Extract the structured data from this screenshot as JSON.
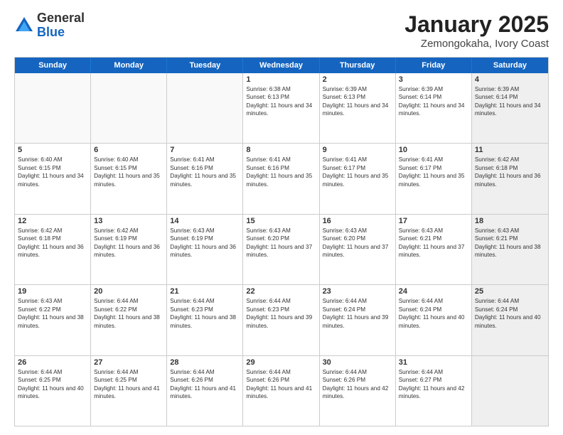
{
  "logo": {
    "general": "General",
    "blue": "Blue"
  },
  "title": "January 2025",
  "subtitle": "Zemongokaha, Ivory Coast",
  "days": [
    "Sunday",
    "Monday",
    "Tuesday",
    "Wednesday",
    "Thursday",
    "Friday",
    "Saturday"
  ],
  "weeks": [
    [
      {
        "day": "",
        "empty": true
      },
      {
        "day": "",
        "empty": true
      },
      {
        "day": "",
        "empty": true
      },
      {
        "day": "1",
        "sunrise": "6:38 AM",
        "sunset": "6:13 PM",
        "daylight": "11 hours and 34 minutes."
      },
      {
        "day": "2",
        "sunrise": "6:39 AM",
        "sunset": "6:13 PM",
        "daylight": "11 hours and 34 minutes."
      },
      {
        "day": "3",
        "sunrise": "6:39 AM",
        "sunset": "6:14 PM",
        "daylight": "11 hours and 34 minutes."
      },
      {
        "day": "4",
        "sunrise": "6:39 AM",
        "sunset": "6:14 PM",
        "daylight": "11 hours and 34 minutes.",
        "shaded": true
      }
    ],
    [
      {
        "day": "5",
        "sunrise": "6:40 AM",
        "sunset": "6:15 PM",
        "daylight": "11 hours and 34 minutes."
      },
      {
        "day": "6",
        "sunrise": "6:40 AM",
        "sunset": "6:15 PM",
        "daylight": "11 hours and 35 minutes."
      },
      {
        "day": "7",
        "sunrise": "6:41 AM",
        "sunset": "6:16 PM",
        "daylight": "11 hours and 35 minutes."
      },
      {
        "day": "8",
        "sunrise": "6:41 AM",
        "sunset": "6:16 PM",
        "daylight": "11 hours and 35 minutes."
      },
      {
        "day": "9",
        "sunrise": "6:41 AM",
        "sunset": "6:17 PM",
        "daylight": "11 hours and 35 minutes."
      },
      {
        "day": "10",
        "sunrise": "6:41 AM",
        "sunset": "6:17 PM",
        "daylight": "11 hours and 35 minutes."
      },
      {
        "day": "11",
        "sunrise": "6:42 AM",
        "sunset": "6:18 PM",
        "daylight": "11 hours and 36 minutes.",
        "shaded": true
      }
    ],
    [
      {
        "day": "12",
        "sunrise": "6:42 AM",
        "sunset": "6:18 PM",
        "daylight": "11 hours and 36 minutes."
      },
      {
        "day": "13",
        "sunrise": "6:42 AM",
        "sunset": "6:19 PM",
        "daylight": "11 hours and 36 minutes."
      },
      {
        "day": "14",
        "sunrise": "6:43 AM",
        "sunset": "6:19 PM",
        "daylight": "11 hours and 36 minutes."
      },
      {
        "day": "15",
        "sunrise": "6:43 AM",
        "sunset": "6:20 PM",
        "daylight": "11 hours and 37 minutes."
      },
      {
        "day": "16",
        "sunrise": "6:43 AM",
        "sunset": "6:20 PM",
        "daylight": "11 hours and 37 minutes."
      },
      {
        "day": "17",
        "sunrise": "6:43 AM",
        "sunset": "6:21 PM",
        "daylight": "11 hours and 37 minutes."
      },
      {
        "day": "18",
        "sunrise": "6:43 AM",
        "sunset": "6:21 PM",
        "daylight": "11 hours and 38 minutes.",
        "shaded": true
      }
    ],
    [
      {
        "day": "19",
        "sunrise": "6:43 AM",
        "sunset": "6:22 PM",
        "daylight": "11 hours and 38 minutes."
      },
      {
        "day": "20",
        "sunrise": "6:44 AM",
        "sunset": "6:22 PM",
        "daylight": "11 hours and 38 minutes."
      },
      {
        "day": "21",
        "sunrise": "6:44 AM",
        "sunset": "6:23 PM",
        "daylight": "11 hours and 38 minutes."
      },
      {
        "day": "22",
        "sunrise": "6:44 AM",
        "sunset": "6:23 PM",
        "daylight": "11 hours and 39 minutes."
      },
      {
        "day": "23",
        "sunrise": "6:44 AM",
        "sunset": "6:24 PM",
        "daylight": "11 hours and 39 minutes."
      },
      {
        "day": "24",
        "sunrise": "6:44 AM",
        "sunset": "6:24 PM",
        "daylight": "11 hours and 40 minutes."
      },
      {
        "day": "25",
        "sunrise": "6:44 AM",
        "sunset": "6:24 PM",
        "daylight": "11 hours and 40 minutes.",
        "shaded": true
      }
    ],
    [
      {
        "day": "26",
        "sunrise": "6:44 AM",
        "sunset": "6:25 PM",
        "daylight": "11 hours and 40 minutes."
      },
      {
        "day": "27",
        "sunrise": "6:44 AM",
        "sunset": "6:25 PM",
        "daylight": "11 hours and 41 minutes."
      },
      {
        "day": "28",
        "sunrise": "6:44 AM",
        "sunset": "6:26 PM",
        "daylight": "11 hours and 41 minutes."
      },
      {
        "day": "29",
        "sunrise": "6:44 AM",
        "sunset": "6:26 PM",
        "daylight": "11 hours and 41 minutes."
      },
      {
        "day": "30",
        "sunrise": "6:44 AM",
        "sunset": "6:26 PM",
        "daylight": "11 hours and 42 minutes."
      },
      {
        "day": "31",
        "sunrise": "6:44 AM",
        "sunset": "6:27 PM",
        "daylight": "11 hours and 42 minutes."
      },
      {
        "day": "",
        "empty": true,
        "shaded": true
      }
    ]
  ],
  "labels": {
    "sunrise_prefix": "Sunrise: ",
    "sunset_prefix": "Sunset: ",
    "daylight_prefix": "Daylight: "
  }
}
